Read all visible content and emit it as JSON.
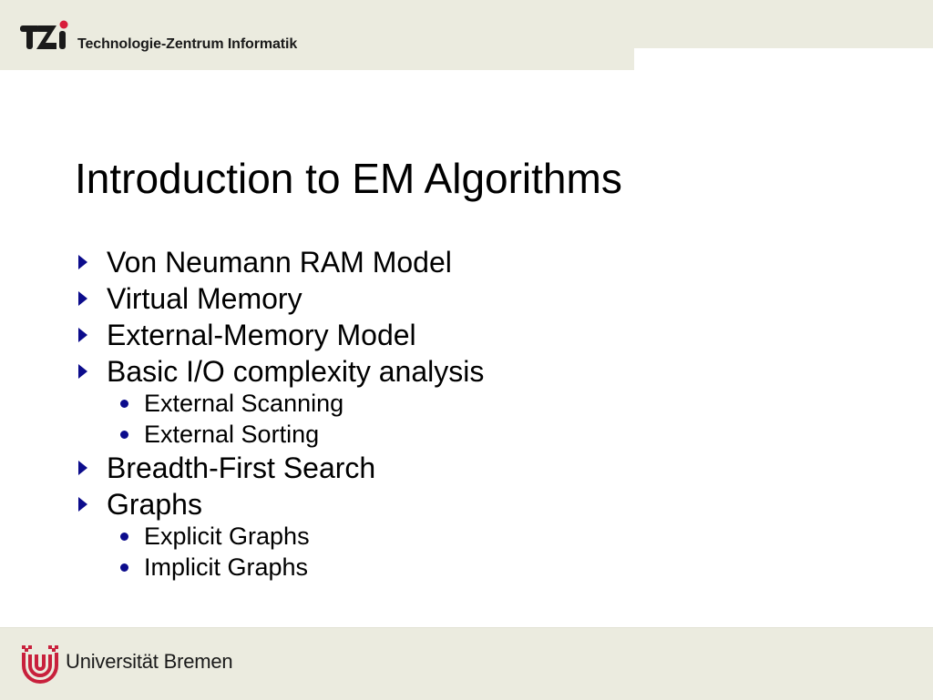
{
  "header": {
    "logo_icon": "tzi-logo-icon",
    "institution": "Technologie-Zentrum Informatik"
  },
  "slide": {
    "title": "Introduction to EM Algorithms",
    "bullets": [
      {
        "text": "Von Neumann RAM Model",
        "sub": []
      },
      {
        "text": "Virtual Memory",
        "sub": []
      },
      {
        "text": "External-Memory Model",
        "sub": []
      },
      {
        "text": "Basic I/O complexity analysis",
        "sub": [
          "External Scanning",
          "External Sorting"
        ]
      },
      {
        "text": "Breadth-First Search",
        "sub": []
      },
      {
        "text": "Graphs",
        "sub": [
          "Explicit Graphs",
          "Implicit Graphs"
        ]
      }
    ]
  },
  "footer": {
    "logo_icon": "uni-bremen-logo-icon",
    "university": "Universität Bremen"
  },
  "colors": {
    "band": "#ebebdf",
    "bullet": "#0c0c8c",
    "logo_red": "#c8203c"
  }
}
